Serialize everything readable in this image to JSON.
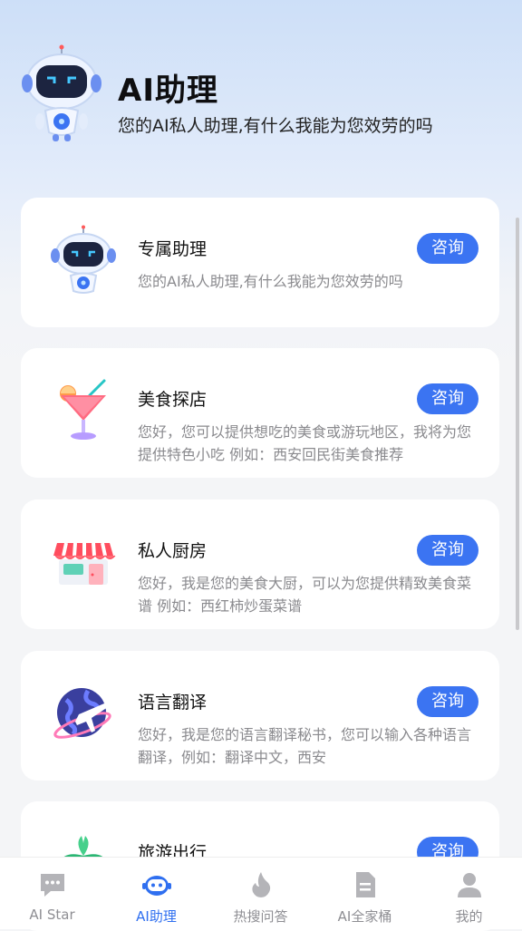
{
  "header": {
    "title": "AI助理",
    "subtitle": "您的AI私人助理,有什么我能为您效劳的吗",
    "mascot_icon": "robot-icon"
  },
  "cards": [
    {
      "name": "专属助理",
      "desc": "您的AI私人助理,有什么我能为您效劳的吗",
      "button": "咨询",
      "icon": "robot-icon"
    },
    {
      "name": "美食探店",
      "desc": "您好，您可以提供想吃的美食或游玩地区，我将为您提供特色小吃 例如：西安回民街美食推荐",
      "button": "咨询",
      "icon": "cocktail-icon"
    },
    {
      "name": "私人厨房",
      "desc": "您好，我是您的美食大厨，可以为您提供精致美食菜谱 例如：西红柿炒蛋菜谱",
      "button": "咨询",
      "icon": "store-icon"
    },
    {
      "name": "语言翻译",
      "desc": "您好，我是您的语言翻译秘书，您可以输入各种语言翻译，例如：翻译中文，西安",
      "button": "咨询",
      "icon": "globe-plane-icon"
    },
    {
      "name": "旅游出行",
      "desc": "",
      "button": "咨询",
      "icon": "palm-tree-icon"
    }
  ],
  "tabs": [
    {
      "label": "AI Star",
      "icon": "chat-bubble-icon",
      "active": false
    },
    {
      "label": "AI助理",
      "icon": "robot-face-icon",
      "active": true
    },
    {
      "label": "热搜问答",
      "icon": "flame-icon",
      "active": false
    },
    {
      "label": "AI全家桶",
      "icon": "document-icon",
      "active": false
    },
    {
      "label": "我的",
      "icon": "user-icon",
      "active": false
    }
  ],
  "colors": {
    "accent": "#3b74f2",
    "active_tab": "#2f6ff0",
    "inactive_tab": "#8e8e93"
  }
}
